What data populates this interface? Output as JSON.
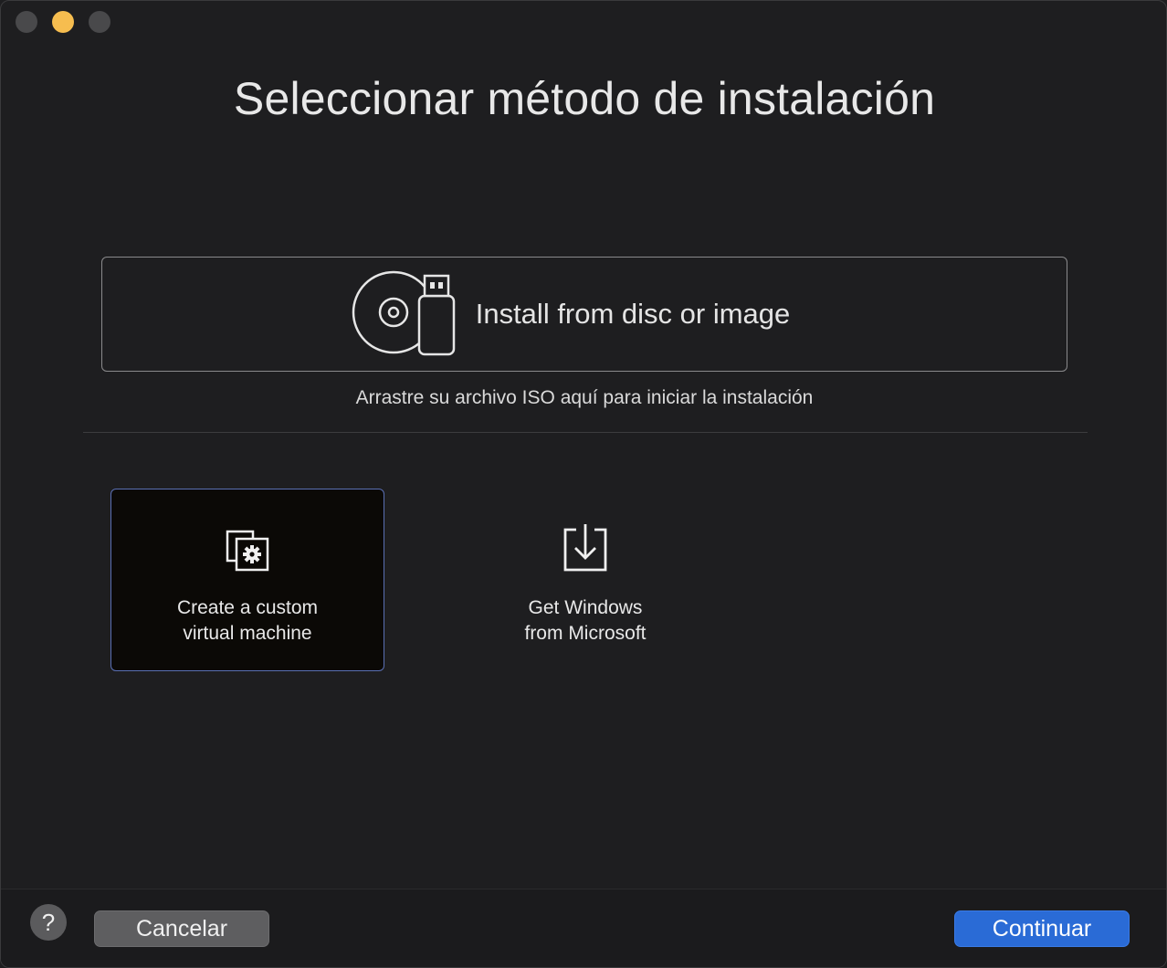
{
  "window": {
    "traffic_lights": [
      "close",
      "minimize",
      "zoom"
    ],
    "accent_minimize": "#f6bd4f"
  },
  "title": "Seleccionar método de instalación",
  "install": {
    "label": "Install from disc or image",
    "icon": "disc-usb-icon",
    "hint": "Arrastre su archivo ISO aquí para iniciar la instalación"
  },
  "options": [
    {
      "line1": "Create a custom",
      "line2": "virtual machine",
      "icon": "custom-vm-gear-icon",
      "selected": true
    },
    {
      "line1": "Get Windows",
      "line2": "from Microsoft",
      "icon": "download-icon",
      "selected": false
    }
  ],
  "footer": {
    "help": "?",
    "cancel": "Cancelar",
    "continue": "Continuar",
    "continue_color": "#2a6bd6"
  }
}
